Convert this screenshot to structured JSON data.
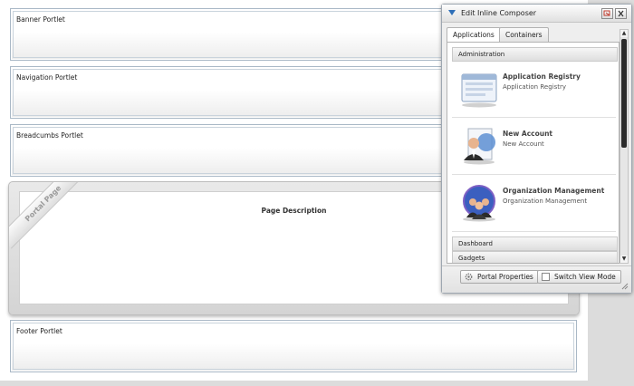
{
  "portlets": {
    "banner": "Banner Portlet",
    "navigation": "Navigation Portlet",
    "breadcrumbs": "Breadcumbs Portlet",
    "footer": "Footer Portlet"
  },
  "portal_page": {
    "ribbon": "Portal Page",
    "description": "Page Description"
  },
  "composer": {
    "title": "Edit Inline Composer",
    "tabs": [
      {
        "label": "Applications",
        "active": true
      },
      {
        "label": "Containers",
        "active": false
      }
    ],
    "categories": {
      "administration": "Administration",
      "dashboard": "Dashboard",
      "gadgets": "Gadgets"
    },
    "apps": [
      {
        "name": "Application Registry",
        "sub": "Application Registry",
        "icon": "application-registry-icon"
      },
      {
        "name": "New Account",
        "sub": "New Account",
        "icon": "new-account-icon"
      },
      {
        "name": "Organization Management",
        "sub": "Organization Management",
        "icon": "organization-management-icon"
      }
    ],
    "buttons": {
      "portal_properties": "Portal Properties",
      "switch_view_mode": "Switch View Mode"
    }
  },
  "colors": {
    "accent": "#2e6fb8",
    "close_red": "#c0392b"
  }
}
